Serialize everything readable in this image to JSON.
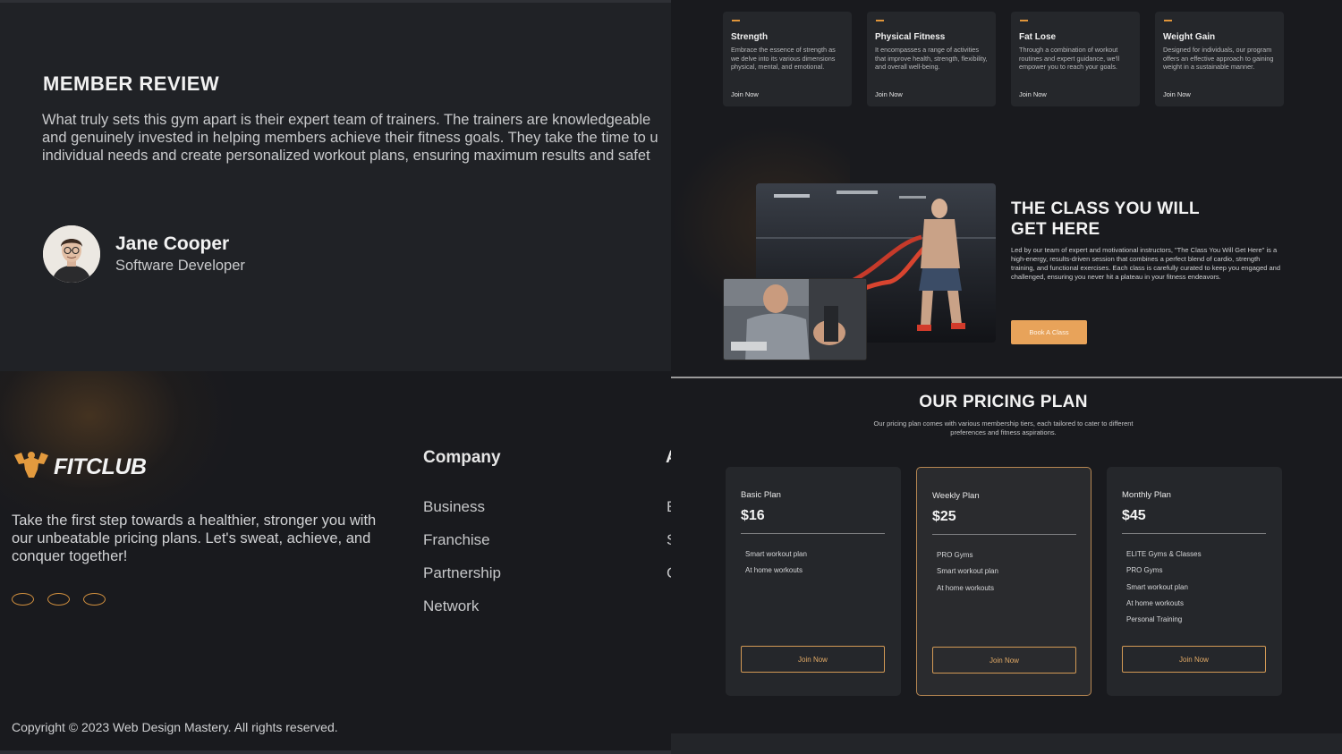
{
  "review": {
    "heading": "MEMBER REVIEW",
    "text_lines": [
      "What truly sets this gym apart is their expert team of trainers. The trainers are knowledgeable",
      "and genuinely invested in helping members achieve their fitness goals. They take the time to u",
      "individual needs and create personalized workout plans, ensuring maximum results and safet"
    ],
    "reviewer": {
      "name": "Jane Cooper",
      "role": "Software Developer"
    }
  },
  "footer": {
    "brand": "FITCLUB",
    "description": "Take the first step towards a healthier, stronger you with our unbeatable pricing plans. Let's sweat, achieve, and conquer together!",
    "socials": [
      "social-icon-1",
      "social-icon-2",
      "social-icon-3"
    ],
    "company": {
      "title": "Company",
      "links": [
        "Business",
        "Franchise",
        "Partnership",
        "Network"
      ]
    },
    "second_column": {
      "title": "A",
      "links": [
        "E",
        "S",
        "C"
      ]
    },
    "copyright": "Copyright © 2023 Web Design Mastery. All rights reserved."
  },
  "services": [
    {
      "title": "Strength",
      "description": "Embrace the essence of strength as we delve into its various dimensions physical, mental, and emotional.",
      "link": "Join Now"
    },
    {
      "title": "Physical Fitness",
      "description": "It encompasses a range of activities that improve health, strength, flexibility, and overall well-being.",
      "link": "Join Now"
    },
    {
      "title": "Fat Lose",
      "description": "Through a combination of workout routines and expert guidance, we'll empower you to reach your goals.",
      "link": "Join Now"
    },
    {
      "title": "Weight Gain",
      "description": "Designed for individuals, our program offers an effective approach to gaining weight in a sustainable manner.",
      "link": "Join Now"
    }
  ],
  "class_section": {
    "heading_lines": [
      "THE CLASS YOU WILL",
      "GET HERE"
    ],
    "description": "Led by our team of expert and motivational instructors, \"The Class You Will Get Here\" is a high-energy, results-driven session that combines a perfect blend of cardio, strength training, and functional exercises. Each class is carefully curated to keep you engaged and challenged, ensuring you never hit a plateau in your fitness endeavors.",
    "button": "Book A Class"
  },
  "pricing": {
    "title": "OUR PRICING PLAN",
    "subtitle": "Our pricing plan comes with various membership tiers, each tailored to cater to different preferences and fitness aspirations.",
    "plans": [
      {
        "name": "Basic Plan",
        "price": "$16",
        "features": [
          "Smart workout plan",
          "At home workouts"
        ],
        "button": "Join Now"
      },
      {
        "name": "Weekly Plan",
        "price": "$25",
        "features": [
          "PRO Gyms",
          "Smart workout plan",
          "At home workouts"
        ],
        "button": "Join Now"
      },
      {
        "name": "Monthly Plan",
        "price": "$45",
        "features": [
          "ELITE Gyms & Classes",
          "PRO Gyms",
          "Smart workout plan",
          "At home workouts",
          "Personal Training"
        ],
        "button": "Join Now"
      }
    ]
  },
  "colors": {
    "accent": "#e8a35a",
    "accent_border": "#d39a55",
    "background": "#191a1e",
    "card": "#25272b"
  }
}
